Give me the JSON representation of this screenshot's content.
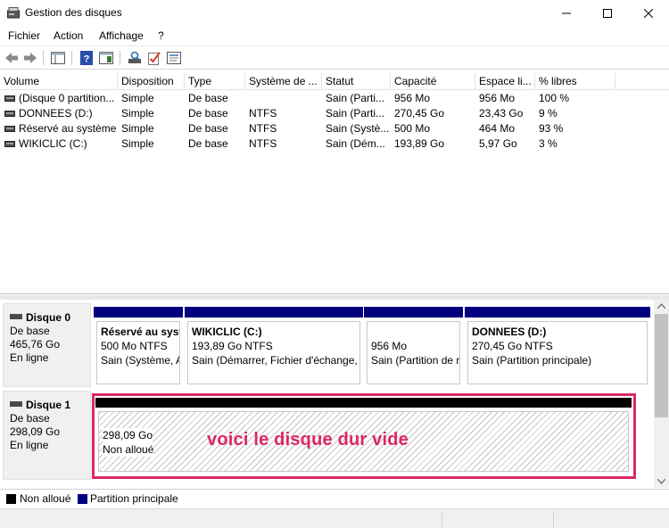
{
  "window": {
    "title": "Gestion des disques"
  },
  "menu": [
    "Fichier",
    "Action",
    "Affichage",
    "?"
  ],
  "volumes": {
    "columns": [
      "Volume",
      "Disposition",
      "Type",
      "Système de ...",
      "Statut",
      "Capacité",
      "Espace li...",
      "% libres"
    ],
    "rows": [
      [
        "(Disque 0 partition...",
        "Simple",
        "De base",
        "",
        "Sain (Parti...",
        "956 Mo",
        "956 Mo",
        "100 %"
      ],
      [
        "DONNEES (D:)",
        "Simple",
        "De base",
        "NTFS",
        "Sain (Parti...",
        "270,45 Go",
        "23,43 Go",
        "9 %"
      ],
      [
        "Réservé au système",
        "Simple",
        "De base",
        "NTFS",
        "Sain (Systè...",
        "500 Mo",
        "464 Mo",
        "93 %"
      ],
      [
        "WIKICLIC (C:)",
        "Simple",
        "De base",
        "NTFS",
        "Sain (Dém...",
        "193,89 Go",
        "5,97 Go",
        "3 %"
      ]
    ]
  },
  "disks": {
    "disk0": {
      "name": "Disque 0",
      "type": "De base",
      "size": "465,76 Go",
      "status": "En ligne",
      "partitions": [
        {
          "name": "Réservé au syst",
          "size": "500 Mo NTFS",
          "status": "Sain (Système, A"
        },
        {
          "name": "WIKICLIC  (C:)",
          "size": "193,89 Go NTFS",
          "status": "Sain (Démarrer, Fichier d'échange, \\"
        },
        {
          "name": "",
          "size": "956 Mo",
          "status": "Sain (Partition de r"
        },
        {
          "name": "DONNEES  (D:)",
          "size": "270,45 Go NTFS",
          "status": "Sain (Partition principale)"
        }
      ]
    },
    "disk1": {
      "name": "Disque 1",
      "type": "De base",
      "size": "298,09 Go",
      "status": "En ligne",
      "partition": {
        "size": "298,09 Go",
        "status": "Non alloué"
      }
    }
  },
  "annotation": "voici le disque dur vide",
  "legend": {
    "unallocated": "Non alloué",
    "primary": "Partition principale"
  },
  "colors": {
    "primary": "#00007f",
    "unallocated": "#000000",
    "highlight": "#dc2861"
  }
}
